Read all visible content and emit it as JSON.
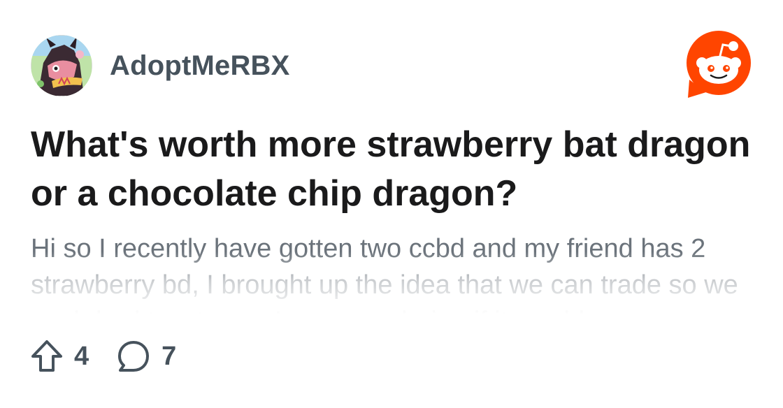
{
  "post": {
    "username": "AdoptMeRBX",
    "title": "What's worth more strawberry bat dragon or a chocolate chip dragon?",
    "body": "Hi so I recently have gotten two ccbd and my friend has 2 strawberry bd, I brought up the idea that we can trade so we each had two types. I was wondering if it would",
    "upvotes": "4",
    "comments": "7"
  },
  "icons": {
    "avatar": "user-avatar-illustration",
    "brand": "reddit-snoo-icon",
    "upvote": "upvote-arrow-icon",
    "comment": "comment-bubble-icon"
  },
  "colors": {
    "brand": "#FF4500",
    "title": "#1A1A1B",
    "username": "#46525C",
    "body": "#6B737B"
  }
}
